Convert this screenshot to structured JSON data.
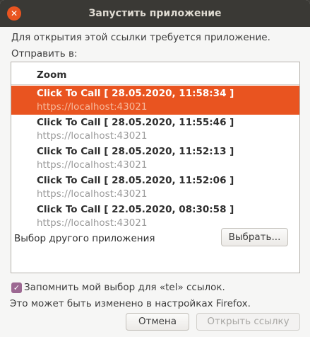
{
  "window": {
    "title": "Запустить приложение",
    "close_glyph": "✕"
  },
  "dialog": {
    "description": "Для открытия этой ссылки требуется приложение.",
    "send_to_label": "Отправить в:"
  },
  "list": {
    "header": "Zoom",
    "items": [
      {
        "name": "Click To Call [ 28.05.2020, 11:58:34 ]",
        "url": "https://localhost:43021",
        "selected": true
      },
      {
        "name": "Click To Call [ 28.05.2020, 11:55:46 ]",
        "url": "https://localhost:43021",
        "selected": false
      },
      {
        "name": "Click To Call [ 28.05.2020, 11:52:13 ]",
        "url": "https://localhost:43021",
        "selected": false
      },
      {
        "name": "Click To Call [ 28.05.2020, 11:52:06 ]",
        "url": "https://localhost:43021",
        "selected": false
      },
      {
        "name": "Click To Call [ 22.05.2020, 08:30:58 ]",
        "url": "https://localhost:43021",
        "selected": false
      }
    ],
    "other_app_label": "Выбор другого приложения",
    "choose_button": "Выбрать..."
  },
  "remember": {
    "checked": true,
    "checkmark_glyph": "✓",
    "label": "Запомнить мой выбор для «tel» ссылок."
  },
  "hint": "Это может быть изменено в настройках Firefox.",
  "buttons": {
    "cancel": "Отмена",
    "open": "Открыть ссылку"
  },
  "colors": {
    "accent": "#e95420",
    "titlebar": "#3a3935",
    "checkbox": "#9c6892"
  },
  "icons": {
    "close": "close-icon",
    "check": "check-icon"
  }
}
